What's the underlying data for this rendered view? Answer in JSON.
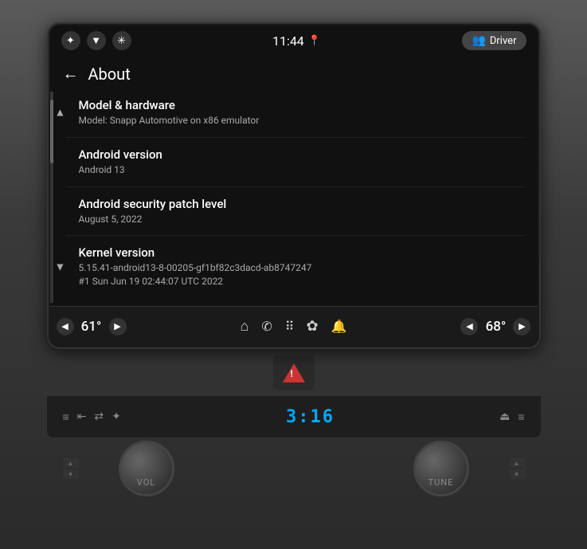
{
  "statusBar": {
    "time": "11:44",
    "locationIcon": "📍",
    "driverLabel": "Driver",
    "icons": {
      "bluetooth": "✦",
      "wifi": "▼",
      "brightness": "✳"
    }
  },
  "header": {
    "backLabel": "←",
    "title": "About"
  },
  "settingsItems": [
    {
      "id": "model-hardware",
      "title": "Model & hardware",
      "subtitle": "Model: Snapp Automotive on x86 emulator",
      "collapsed": false,
      "hasCollapseToggle": true,
      "toggleState": "up"
    },
    {
      "id": "android-version",
      "title": "Android version",
      "subtitle": "Android 13",
      "collapsed": false,
      "hasCollapseToggle": false
    },
    {
      "id": "security-patch",
      "title": "Android security patch level",
      "subtitle": "August 5, 2022",
      "collapsed": false,
      "hasCollapseToggle": false
    },
    {
      "id": "kernel-version",
      "title": "Kernel version",
      "subtitle": "5.15.41-android13-8-00205-gf1bf82c3dacd-ab8747247\n#1 Sun Jun 19 02:44:07 UTC 2022",
      "collapsed": false,
      "hasCollapseToggle": true,
      "toggleState": "down"
    }
  ],
  "bottomBar": {
    "leftTemp": "61°",
    "rightTemp": "68°",
    "navIcons": {
      "home": "⌂",
      "phone": "✆",
      "grid": "⋮⋮",
      "fan": "✿",
      "bell": "🔔"
    }
  },
  "digitalClock": "3:16",
  "knobs": {
    "left": "VOL",
    "right": "TUNE"
  }
}
